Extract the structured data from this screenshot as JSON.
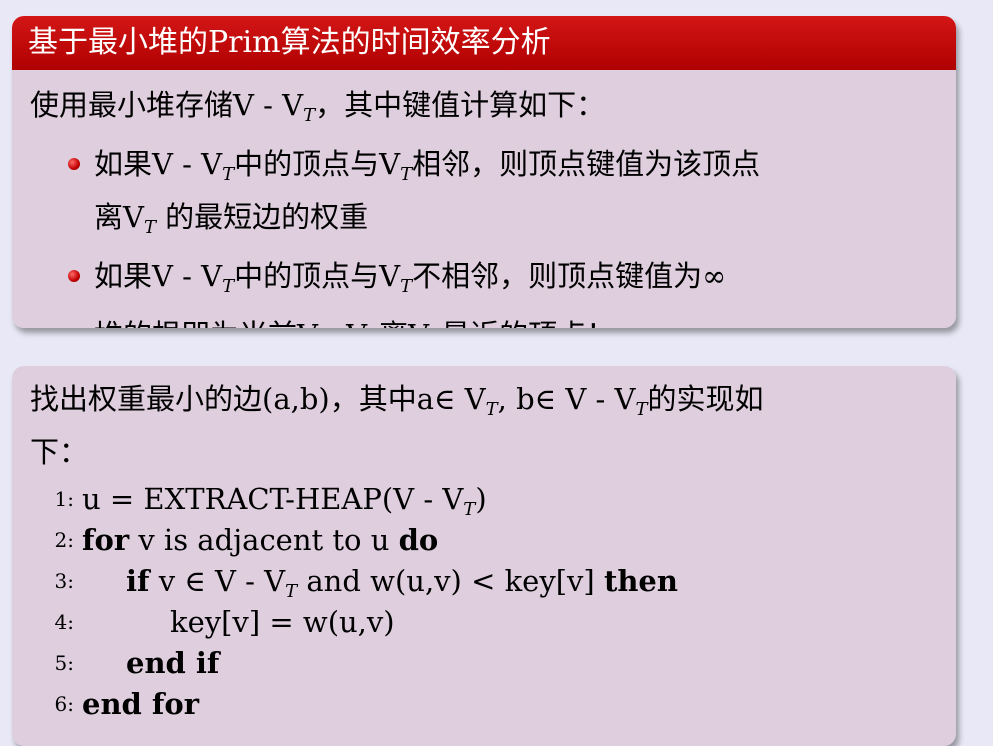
{
  "block1": {
    "title": "基于最小堆的Prim算法的时间效率分析",
    "intro": {
      "a": "使用最小堆存储V - V",
      "sub": "T",
      "b": "，其中键值计算如下："
    },
    "bullets": [
      {
        "a": "如果V - V",
        "s1": "T",
        "b": "中的顶点与V",
        "s2": "T",
        "c": "相邻，则顶点键值为该顶点",
        "d": "离V",
        "s3": "T",
        "e": " 的最短边的权重"
      },
      {
        "a": "如果V - V",
        "s1": "T",
        "b": "中的顶点与V",
        "s2": "T",
        "c": "不相邻，则顶点键值为∞"
      },
      {
        "a": "堆的根即为当前V - V",
        "s1": "T",
        "b": "离V",
        "s2": "T",
        "c": "最近的顶点！"
      }
    ]
  },
  "block2": {
    "intro": {
      "a": "找出权重最小的边(a,b)，其中a∈ V",
      "s1": "T",
      "b": ", b∈ V - V",
      "s2": "T",
      "c": "的实现如",
      "d": "下："
    },
    "lines": [
      {
        "num": "1:",
        "a": "u = EXTRACT-HEAP(V - V",
        "sub": "T",
        "b": ")"
      },
      {
        "num": "2:",
        "kw1": "for",
        "text": " v is adjacent to u ",
        "kw2": "do"
      },
      {
        "num": "3:",
        "kw1": "if",
        "a": " v ∈ V - V",
        "sub": "T",
        "b": " and w(u,v) < key[v] ",
        "kw2": "then"
      },
      {
        "num": "4:",
        "text": "key[v] = w(u,v)"
      },
      {
        "num": "5:",
        "kw": "end if"
      },
      {
        "num": "6:",
        "kw": "end for"
      }
    ]
  }
}
